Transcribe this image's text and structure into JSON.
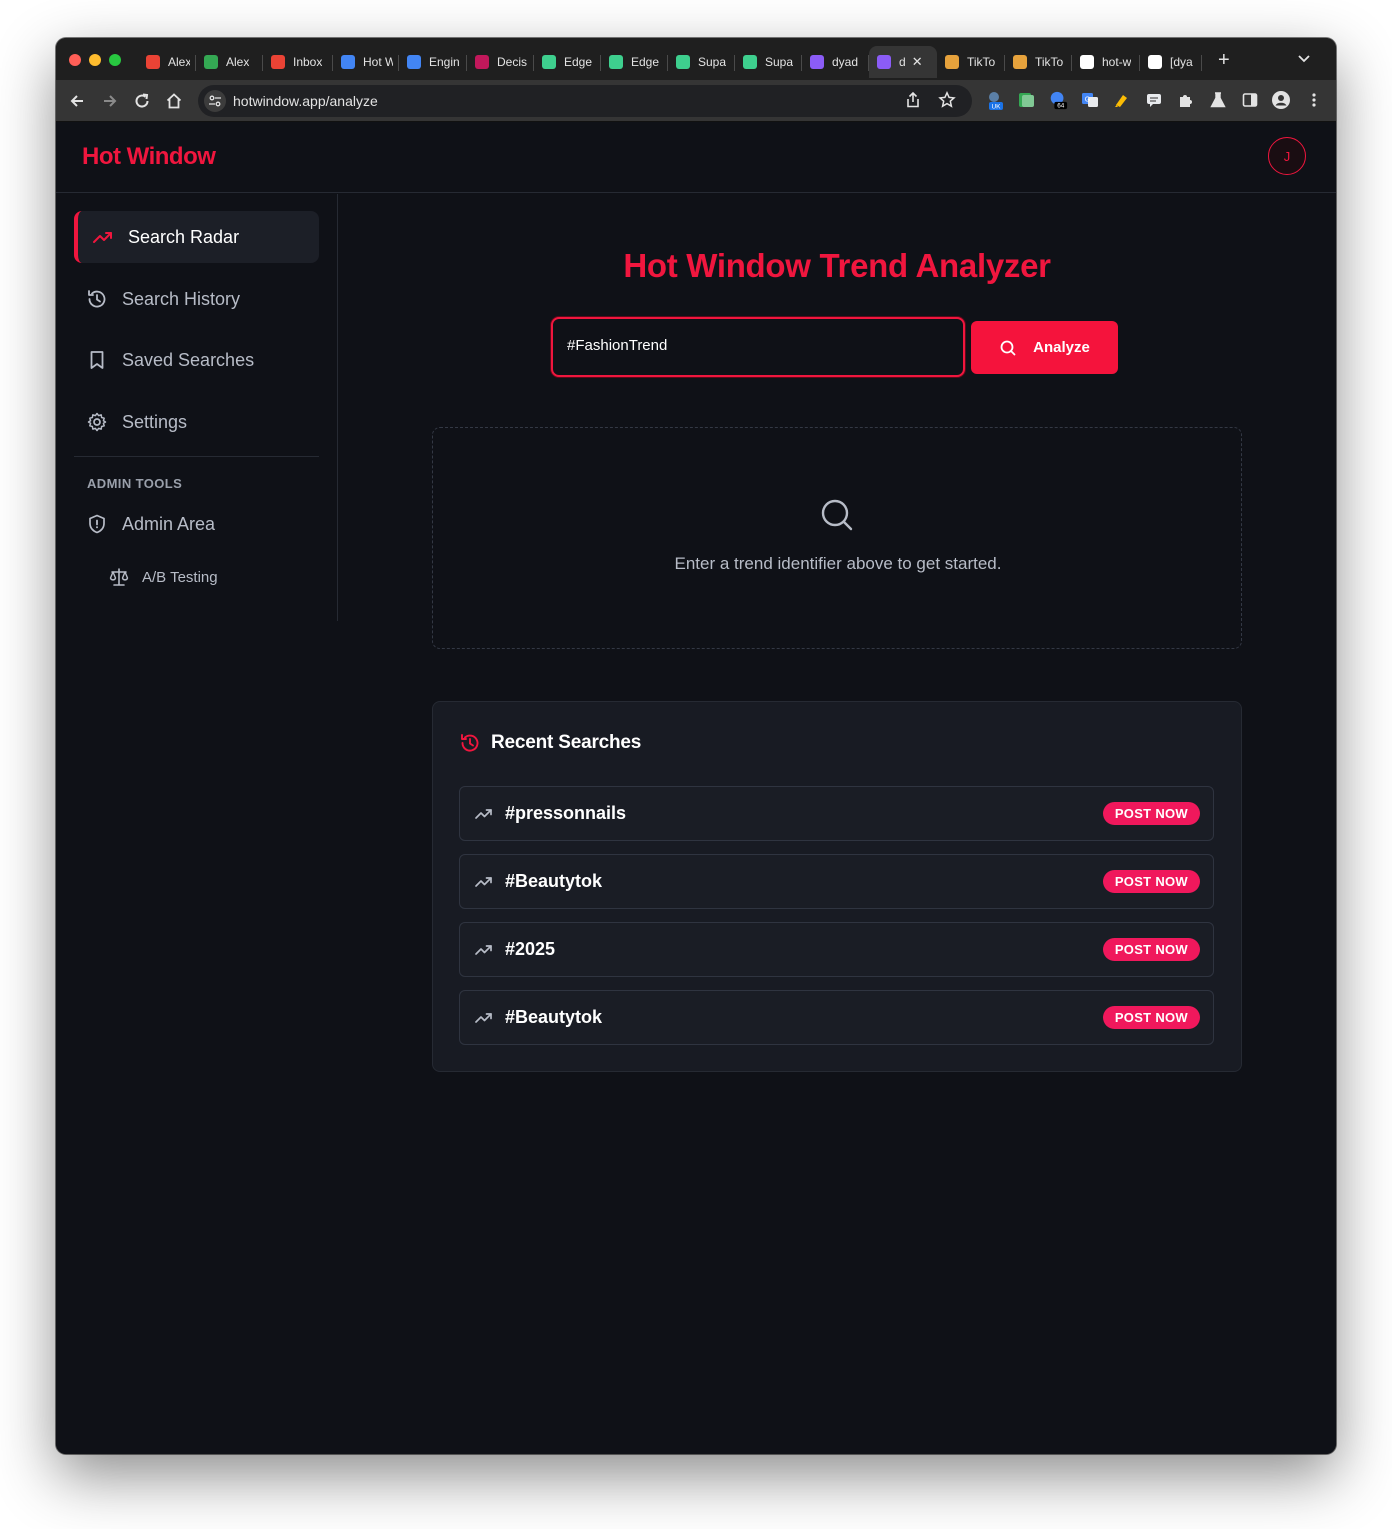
{
  "browser": {
    "tabs": [
      {
        "title": "Alex",
        "icon": "gmail-icon",
        "color": "#ea4335"
      },
      {
        "title": "Alex",
        "icon": "chat-icon",
        "color": "#34a853"
      },
      {
        "title": "Inbox",
        "icon": "gmail-icon",
        "color": "#ea4335"
      },
      {
        "title": "Hot W",
        "icon": "docs-icon",
        "color": "#4285f4"
      },
      {
        "title": "Engin",
        "icon": "docs-icon",
        "color": "#4285f4"
      },
      {
        "title": "Decis",
        "icon": "m-icon",
        "color": "#c2185b"
      },
      {
        "title": "Edge",
        "icon": "bolt-icon",
        "color": "#3ecf8e"
      },
      {
        "title": "Edge",
        "icon": "bolt-icon",
        "color": "#3ecf8e"
      },
      {
        "title": "Supa",
        "icon": "bolt-icon",
        "color": "#3ecf8e"
      },
      {
        "title": "Supa",
        "icon": "bolt-icon",
        "color": "#3ecf8e"
      },
      {
        "title": "dyad",
        "icon": "dyad-icon",
        "color": "#8b5cf6"
      },
      {
        "title": "d",
        "icon": "dyad-icon",
        "color": "#8b5cf6",
        "active": true
      },
      {
        "title": "TikTo",
        "icon": "tiktok-icon",
        "color": "#e6a23c"
      },
      {
        "title": "TikTo",
        "icon": "tiktok-icon",
        "color": "#e6a23c"
      },
      {
        "title": "hot-w",
        "icon": "vercel-icon",
        "color": "#ffffff"
      },
      {
        "title": "[dya",
        "icon": "github-icon",
        "color": "#ffffff"
      }
    ],
    "url": "hotwindow.app/analyze",
    "ext_badges": {
      "uk": "UK",
      "count": "64"
    }
  },
  "app": {
    "logo": "Hot Window",
    "avatar_initial": "J",
    "accent": "#f0163e"
  },
  "sidebar": {
    "items": [
      {
        "label": "Search Radar",
        "icon": "trending-up-icon",
        "active": true
      },
      {
        "label": "Search History",
        "icon": "history-icon"
      },
      {
        "label": "Saved Searches",
        "icon": "bookmark-icon"
      },
      {
        "label": "Settings",
        "icon": "gear-icon"
      }
    ],
    "admin_section_label": "ADMIN TOOLS",
    "admin_item": {
      "label": "Admin Area",
      "icon": "shield-icon"
    },
    "admin_sub": {
      "label": "A/B Testing",
      "icon": "scale-icon"
    }
  },
  "main": {
    "title": "Hot Window Trend Analyzer",
    "search_value": "#FashionTrend",
    "analyze_label": "Analyze",
    "empty_message": "Enter a trend identifier above to get started."
  },
  "recent": {
    "title": "Recent Searches",
    "badge_label": "POST NOW",
    "items": [
      {
        "tag": "#pressonnails"
      },
      {
        "tag": "#Beautytok"
      },
      {
        "tag": "#2025"
      },
      {
        "tag": "#Beautytok"
      }
    ]
  }
}
